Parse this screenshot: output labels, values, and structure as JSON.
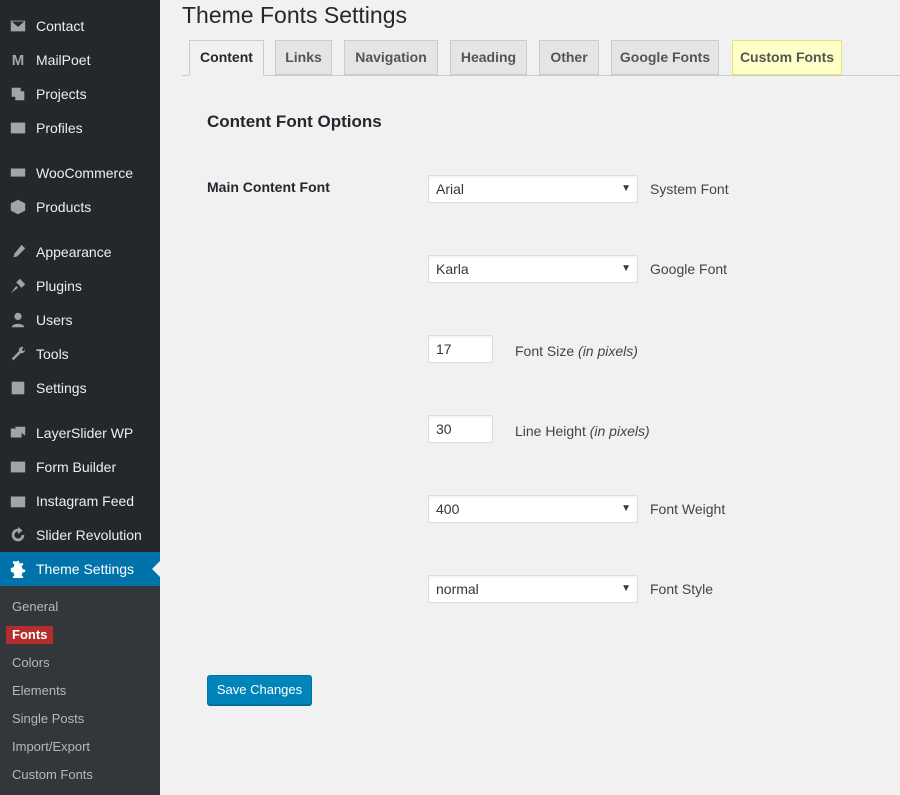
{
  "sidebar": {
    "items": [
      {
        "label": "Contact",
        "icon": "mail-icon"
      },
      {
        "label": "MailPoet",
        "icon": "mailpoet-icon"
      },
      {
        "label": "Projects",
        "icon": "projects-icon"
      },
      {
        "label": "Profiles",
        "icon": "profiles-icon"
      },
      {
        "label": "WooCommerce",
        "icon": "woocommerce-icon"
      },
      {
        "label": "Products",
        "icon": "products-icon"
      },
      {
        "label": "Appearance",
        "icon": "appearance-icon"
      },
      {
        "label": "Plugins",
        "icon": "plugins-icon"
      },
      {
        "label": "Users",
        "icon": "users-icon"
      },
      {
        "label": "Tools",
        "icon": "tools-icon"
      },
      {
        "label": "Settings",
        "icon": "settings-icon"
      },
      {
        "label": "LayerSlider WP",
        "icon": "layerslider-icon"
      },
      {
        "label": "Form Builder",
        "icon": "form-builder-icon"
      },
      {
        "label": "Instagram Feed",
        "icon": "instagram-icon"
      },
      {
        "label": "Slider Revolution",
        "icon": "slider-revolution-icon"
      },
      {
        "label": "Theme Settings",
        "icon": "gear-icon"
      }
    ],
    "submenu": [
      "General",
      "Fonts",
      "Colors",
      "Elements",
      "Single Posts",
      "Import/Export",
      "Custom Fonts"
    ]
  },
  "page": {
    "title": "Theme Fonts Settings",
    "tabs": [
      "Content",
      "Links",
      "Navigation",
      "Heading",
      "Other",
      "Google Fonts",
      "Custom Fonts"
    ],
    "section_title": "Content Font Options",
    "field_label": "Main Content Font",
    "system_font": {
      "value": "Arial",
      "desc": "System Font"
    },
    "google_font": {
      "value": "Karla",
      "desc": "Google Font"
    },
    "font_size": {
      "value": "17",
      "desc": "Font Size",
      "hint": "(in pixels)"
    },
    "line_height": {
      "value": "30",
      "desc": "Line Height",
      "hint": "(in pixels)"
    },
    "font_weight": {
      "value": "400",
      "desc": "Font Weight"
    },
    "font_style": {
      "value": "normal",
      "desc": "Font Style"
    },
    "save_label": "Save Changes"
  },
  "colors": {
    "sidebar": "#23282d",
    "active": "#0073aa",
    "current_sub": "#b32d2e",
    "custom_tab": "#ffffc8"
  }
}
